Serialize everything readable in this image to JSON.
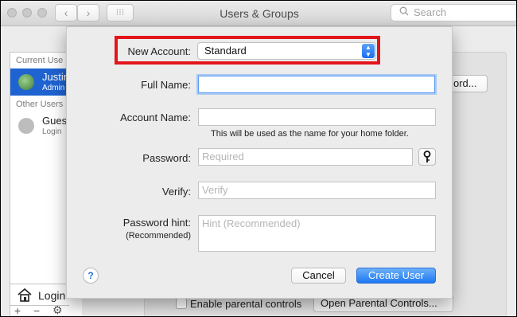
{
  "window": {
    "title": "Users & Groups"
  },
  "toolbar": {
    "back_icon": "‹",
    "forward_icon": "›",
    "grid_icon": "⁝⁝⁝",
    "search_placeholder": "Search"
  },
  "sidebar": {
    "current_header": "Current Use",
    "current_user": {
      "name": "Justin",
      "role": "Admin"
    },
    "other_header": "Other Users",
    "guest": {
      "name": "Gues",
      "role": "Login"
    },
    "login_label": "Login",
    "add_icon": "+",
    "remove_icon": "−",
    "gear_icon": "⚙"
  },
  "background": {
    "password_button": "ord...",
    "parental_checkbox_label": "Enable parental controls",
    "open_parental_button": "Open Parental Controls..."
  },
  "dialog": {
    "new_account_label": "New Account:",
    "new_account_value": "Standard",
    "full_name_label": "Full Name:",
    "full_name_value": "",
    "account_name_label": "Account Name:",
    "account_name_value": "",
    "account_hint": "This will be used as the name for your home folder.",
    "password_label": "Password:",
    "password_placeholder": "Required",
    "verify_label": "Verify:",
    "verify_placeholder": "Verify",
    "hint_label": "Password hint:",
    "hint_sublabel": "(Recommended)",
    "hint_placeholder": "Hint (Recommended)",
    "help_label": "?",
    "cancel_label": "Cancel",
    "create_label": "Create User"
  },
  "colors": {
    "accent": "#1e78f2",
    "highlight": "#e4141b",
    "selection": "#1f63d1"
  }
}
